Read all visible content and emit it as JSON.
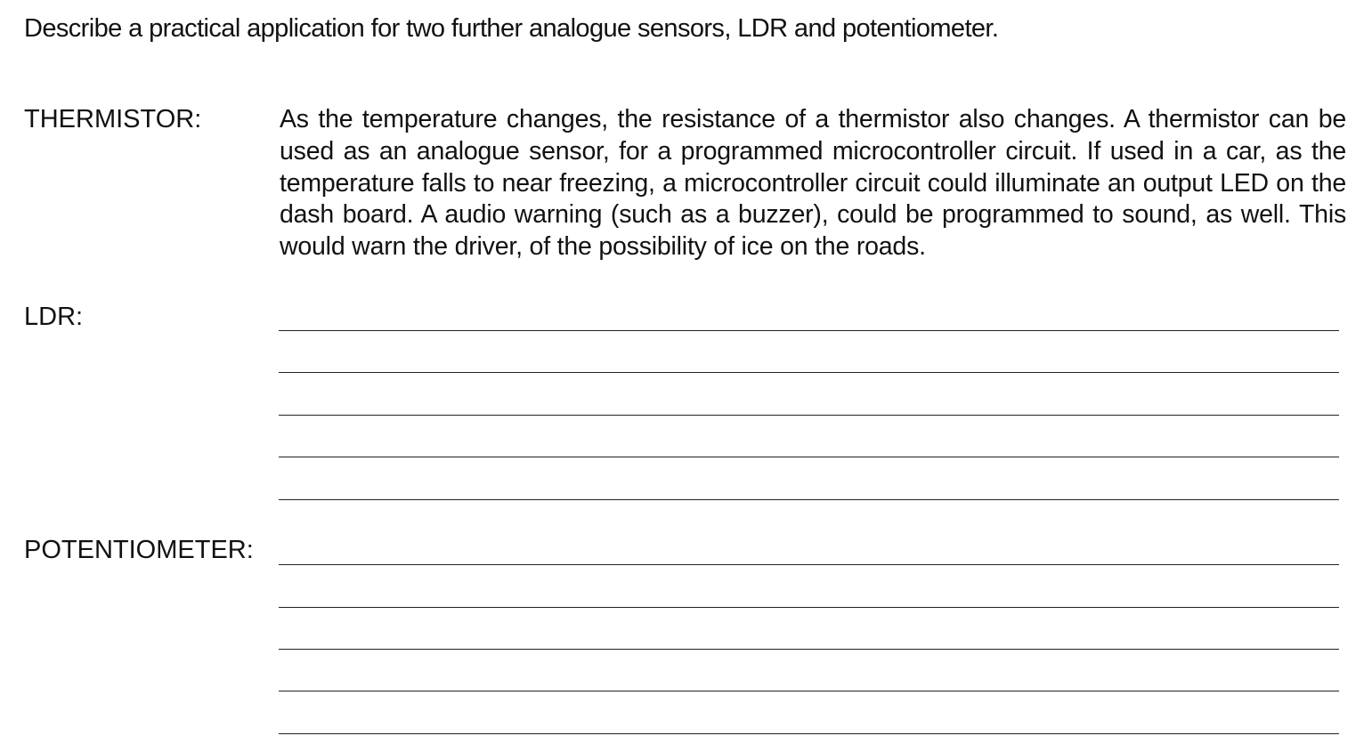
{
  "question": "Describe a practical application for two further analogue sensors, LDR and potentiometer.",
  "sections": {
    "thermistor": {
      "label": "THERMISTOR:",
      "answer": "As the temperature changes, the resistance of a thermistor also changes. A thermistor can be used as an analogue sensor, for a programmed microcontroller circuit. If used in a car, as the temperature falls to near freezing, a microcontroller circuit could illuminate an output LED on the dash board. A audio warning (such as a buzzer), could be programmed to sound, as well. This would warn the driver, of the possibility of ice on the roads."
    },
    "ldr": {
      "label": "LDR:",
      "answer_lines": 5
    },
    "potentiometer": {
      "label": "POTENTIOMETER:",
      "answer_lines": 5
    }
  }
}
